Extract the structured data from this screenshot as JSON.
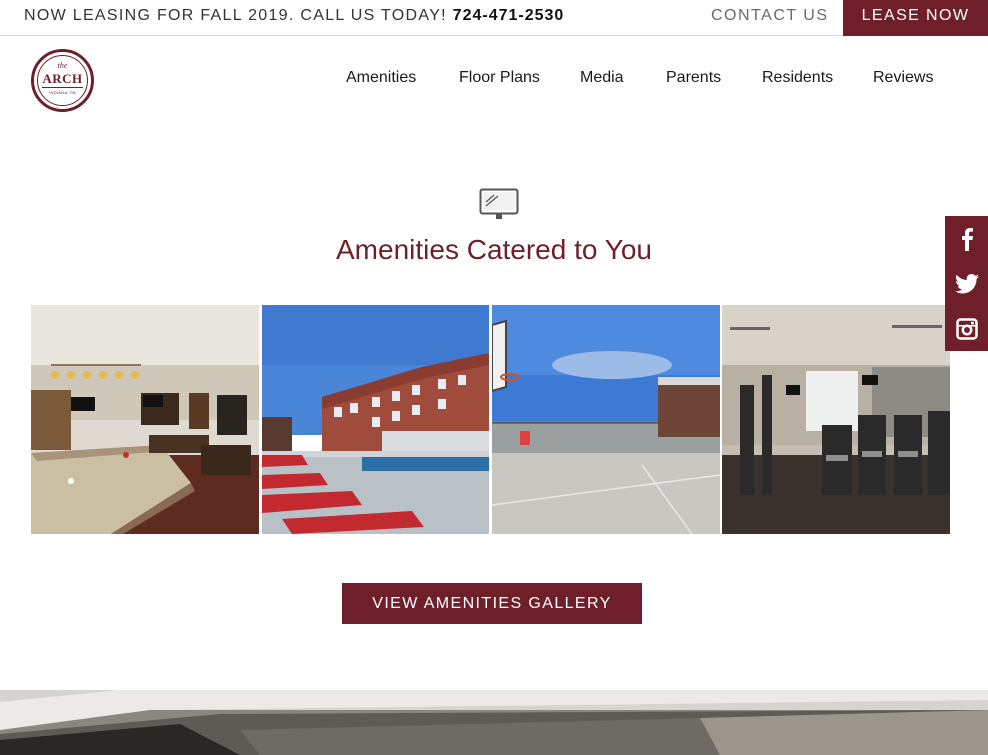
{
  "topbar": {
    "promo_text": "NOW LEASING FOR FALL 2019. CALL US TODAY!",
    "phone": "724-471-2530",
    "contact_label": "CONTACT US",
    "lease_label": "LEASE NOW"
  },
  "logo": {
    "the": "the",
    "word": "ARCH",
    "place": "INDIANA, PA"
  },
  "nav": {
    "items": [
      "Amenities",
      "Floor Plans",
      "Media",
      "Parents",
      "Residents",
      "Reviews"
    ]
  },
  "amenities": {
    "icon": "monitor-icon",
    "title": "Amenities Catered to You",
    "photos": [
      "game-room-photo",
      "pool-deck-photo",
      "basketball-court-photo",
      "fitness-center-photo"
    ],
    "button_label": "VIEW AMENITIES GALLERY"
  },
  "social": {
    "icons": [
      "facebook-icon",
      "twitter-icon",
      "instagram-icon"
    ]
  },
  "colors": {
    "brand": "#6e1f29",
    "text": "#1a1a1a",
    "muted": "#6a6a6a"
  }
}
